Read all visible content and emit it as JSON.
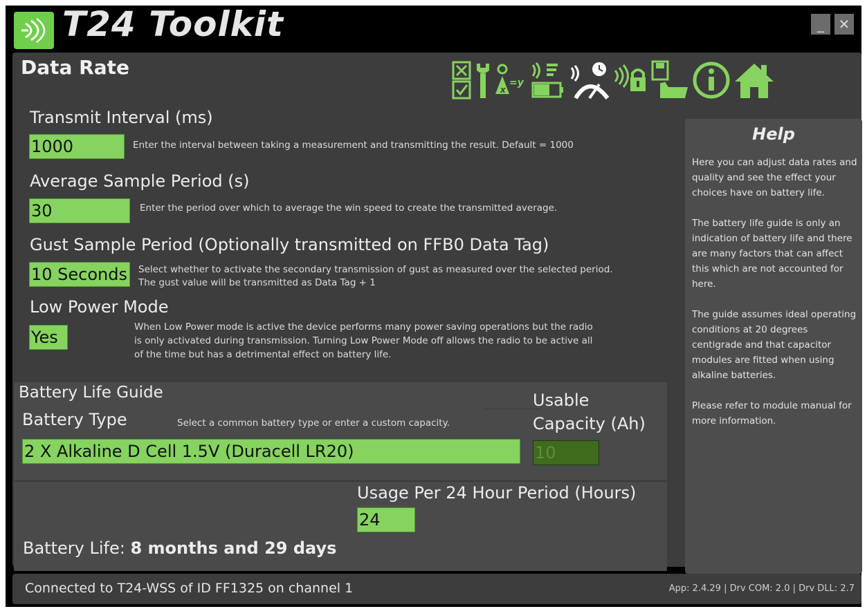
{
  "window": {
    "title": "T24 Toolkit",
    "minimize_label": "_",
    "close_label": "✕"
  },
  "page": {
    "title": "Data Rate"
  },
  "toolbar": {
    "items": [
      {
        "icon": "checklist-icon"
      },
      {
        "icon": "wrench-icon"
      },
      {
        "icon": "formula-icon"
      },
      {
        "icon": "signal-battery-icon"
      },
      {
        "icon": "signal-gauge-icon"
      },
      {
        "icon": "signal-lock-icon"
      },
      {
        "icon": "save-open-icon"
      },
      {
        "icon": "info-icon"
      },
      {
        "icon": "home-icon"
      }
    ]
  },
  "transmit_interval": {
    "label": "Transmit Interval (ms)",
    "value": "1000",
    "description": "Enter the interval between taking a measurement and transmitting the result.  Default = 1000"
  },
  "average_sample": {
    "label": "Average Sample Period (s)",
    "value": "30",
    "description": "Enter the period over which to average the win speed to create the transmitted average."
  },
  "gust_sample": {
    "label": "Gust Sample Period (Optionally transmitted on FFB0 Data Tag)",
    "value": "10 Seconds",
    "description_line1": "Select whether to activate the secondary transmission of gust as measured over the selected period.",
    "description_line2": "The gust value will be transmitted as Data Tag + 1"
  },
  "low_power": {
    "label": "Low Power Mode",
    "value": "Yes",
    "description_line1": "When Low Power mode is active the device performs many power saving operations but the radio",
    "description_line2": "is only activated during transmission. Turning Low Power Mode off allows the radio to be active all",
    "description_line3": "of the time but has a detrimental effect on battery life."
  },
  "battery": {
    "section_title": "Battery Life Guide",
    "type_label": "Battery Type",
    "type_hint": "Select a common battery type or enter a custom capacity.",
    "type_value": "2 X Alkaline D Cell 1.5V (Duracell LR20)",
    "capacity_label_line1": "Usable",
    "capacity_label_line2": "Capacity (Ah)",
    "capacity_value": "10",
    "usage_label": "Usage Per 24 Hour Period (Hours)",
    "usage_value": "24",
    "life_label": "Battery Life:",
    "life_value": "8 months and 29 days"
  },
  "help": {
    "title": "Help",
    "text": "Here you can adjust data rates and quality and see the effect your choices have on battery life.\n\nThe battery life guide is only an indication of battery life and there are many factors that can affect this which are not accounted for here.\n\nThe guide assumes ideal operating conditions at 20 degrees centigrade and that capacitor modules are fitted when using alkaline batteries.\n\nPlease refer to module manual for more information."
  },
  "status": {
    "connection": "Connected to T24-WSS of ID FF1325 on channel 1",
    "versions": "App: 2.4.29 | Drv COM: 2.0 | Drv DLL: 2.7"
  },
  "colors": {
    "accent": "#86d35f",
    "panel": "#3d3d3d",
    "frame": "#000000",
    "disabled_input": "#3f6b1f"
  }
}
